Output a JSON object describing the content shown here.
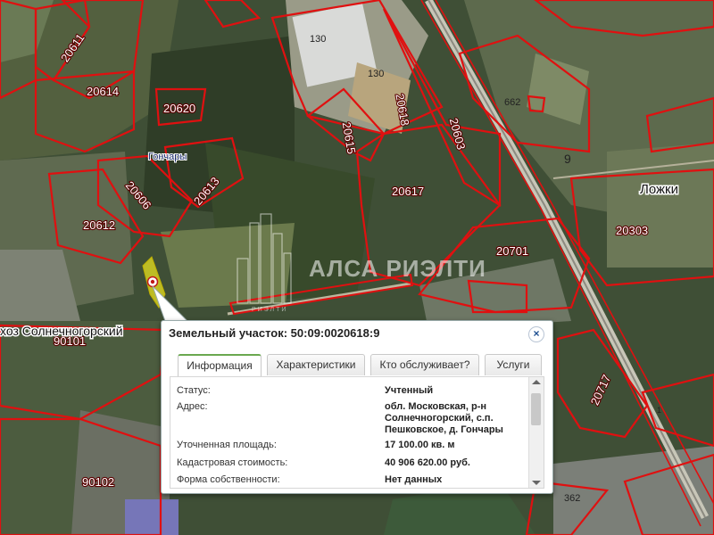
{
  "map": {
    "parcel_labels": [
      "20611",
      "20614",
      "20620",
      "20615",
      "20618",
      "130",
      "130",
      "20603",
      "662",
      "20606",
      "20613",
      "20617",
      "20612",
      "20701",
      "20303",
      "20717",
      "90101",
      "90102",
      "362",
      "9",
      "1"
    ],
    "places": {
      "gonchary": "Гончары",
      "lozhki": "Ложки",
      "solnechnogorsky": "хоз Солнечногорский"
    },
    "watermark": {
      "text": "АЛСА РИЭЛТИ",
      "sub": "РИЭЛТИ"
    },
    "colors": {
      "parcel_border": "#e01010",
      "selected_parcel": "#e8e020"
    }
  },
  "popup": {
    "title": "Земельный участок: 50:09:0020618:9",
    "close_label": "×",
    "tabs": [
      {
        "label": "Информация",
        "active": true
      },
      {
        "label": "Характеристики",
        "active": false
      },
      {
        "label": "Кто обслуживает?",
        "active": false
      },
      {
        "label": "Услуги",
        "active": false
      }
    ],
    "rows": [
      {
        "label": "Статус:",
        "value": "Учтенный"
      },
      {
        "label": "Адрес:",
        "value_lines": [
          "обл. Московская, р-н",
          "Солнечногорский, с.п.",
          "Пешковское, д. Гончары"
        ]
      },
      {
        "label": "Уточненная площадь:",
        "value": "17 100.00 кв. м"
      },
      {
        "label": "Кадастровая стоимость:",
        "value": "40 906 620.00 руб."
      },
      {
        "label": "Форма собственности:",
        "value": "Нет данных"
      }
    ]
  }
}
